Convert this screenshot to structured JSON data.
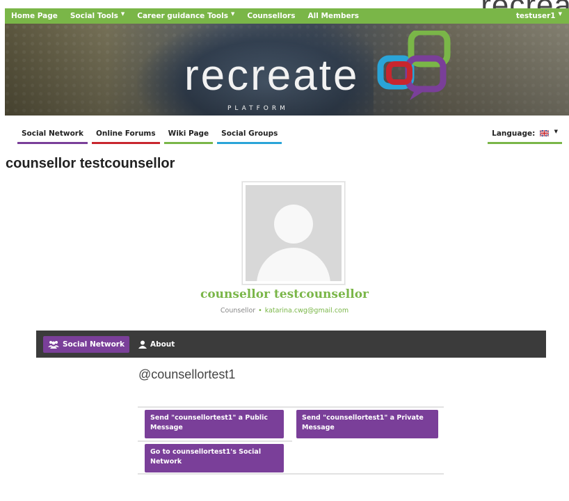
{
  "corner_word": "recrea",
  "topnav": {
    "items": [
      {
        "label": "Home Page",
        "dropdown": false
      },
      {
        "label": "Social Tools",
        "dropdown": true
      },
      {
        "label": "Career guidance Tools",
        "dropdown": true
      },
      {
        "label": "Counsellors",
        "dropdown": false
      },
      {
        "label": "All Members",
        "dropdown": false
      }
    ],
    "user": "testuser1"
  },
  "banner": {
    "logo_word": "recreate",
    "logo_sub": "PLATFORM"
  },
  "subnav": {
    "tabs": [
      "Social Network",
      "Online Forums",
      "Wiki Page",
      "Social Groups"
    ],
    "language_label": "Language:"
  },
  "page_title": "counsellor testcounsellor",
  "profile": {
    "name": "counsellor testcounsellor",
    "role": "Counsellor",
    "email": "katarina.cwg@gmail.com"
  },
  "profile_tabs": {
    "social_network": "Social Network",
    "about": "About"
  },
  "handle": "@counsellortest1",
  "actions": {
    "public_message": "Send \"counsellortest1\" a Public Message",
    "private_message": "Send \"counsellortest1\" a Private Message",
    "go_social": "Go to counsellortest1's Social Network"
  },
  "colors": {
    "green": "#7ab648",
    "purple": "#7a3f99",
    "red": "#c8262e",
    "blue": "#2aa4d8",
    "dark": "#3b3b3b"
  },
  "icons": {
    "social_network": "users-icon",
    "about": "user-icon",
    "language": "uk-flag-icon"
  }
}
